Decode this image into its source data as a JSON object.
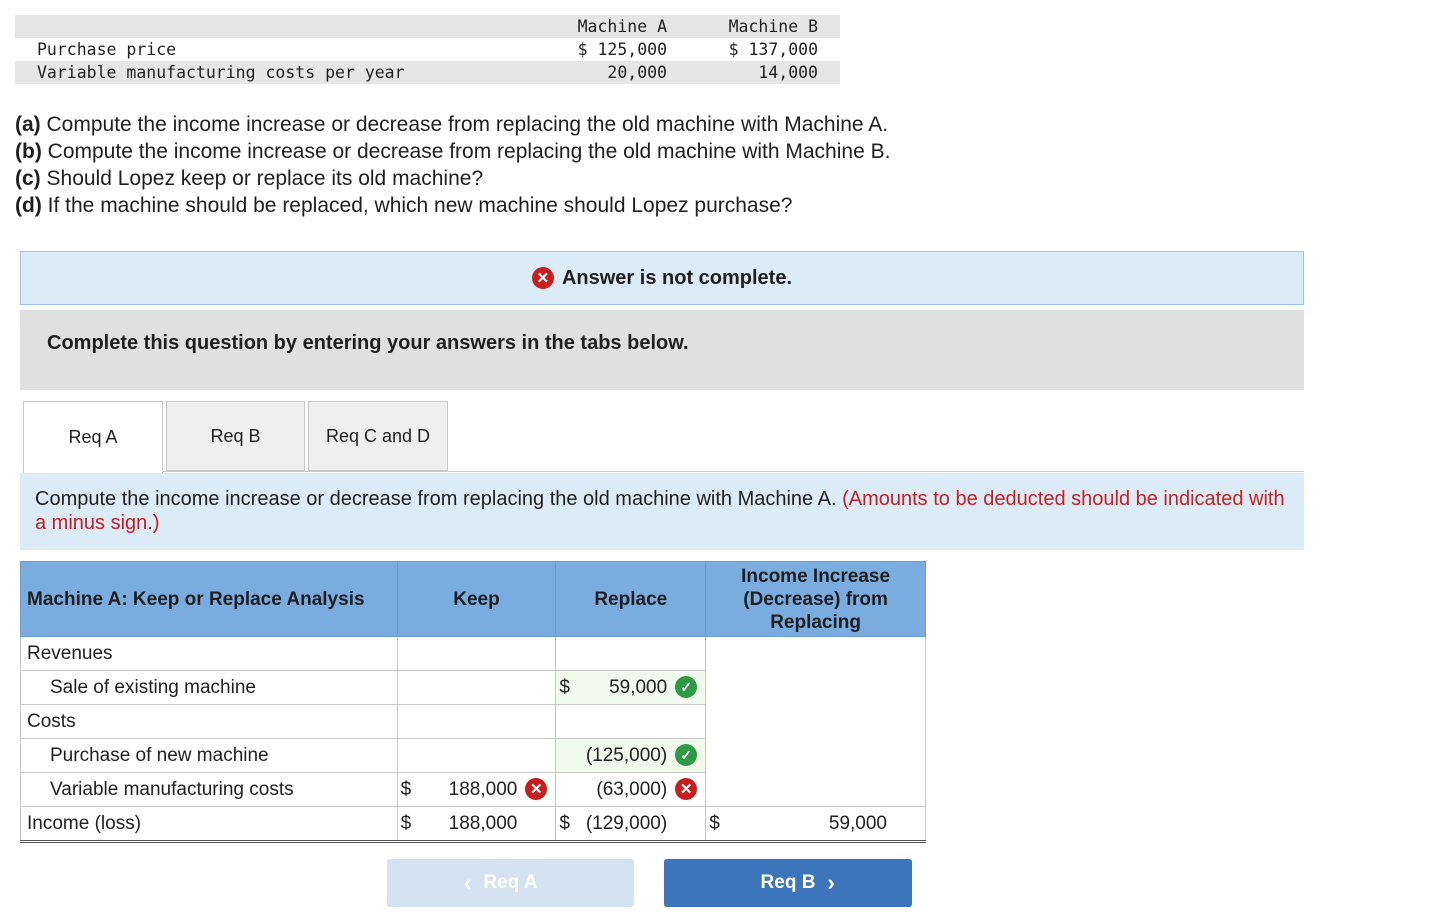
{
  "given_table": {
    "header_a": "Machine A",
    "header_b": "Machine B",
    "rows": [
      {
        "label": "Purchase price",
        "a": "$ 125,000",
        "b": "$ 137,000"
      },
      {
        "label": "Variable manufacturing costs per year",
        "a": "20,000",
        "b": "14,000"
      }
    ]
  },
  "questions": [
    {
      "tag": "(a)",
      "text": " Compute the income increase or decrease from replacing the old machine with Machine A."
    },
    {
      "tag": "(b)",
      "text": " Compute the income increase or decrease from replacing the old machine with Machine B."
    },
    {
      "tag": "(c)",
      "text": " Should Lopez keep or replace its old machine?"
    },
    {
      "tag": "(d)",
      "text": " If the machine should be replaced, which new machine should Lopez purchase?"
    }
  ],
  "banner": {
    "text": "Answer is not complete.",
    "icon": "x-circle-icon",
    "color": "#c81e1e"
  },
  "instruction": "Complete this question by entering your answers in the tabs below.",
  "tabs": [
    {
      "label": "Req A",
      "active": true
    },
    {
      "label": "Req B",
      "active": false
    },
    {
      "label": "Req C and D",
      "active": false
    }
  ],
  "prompt": {
    "text": "Compute the income increase or decrease from replacing the old machine with Machine A.",
    "note": "(Amounts to be deducted should be indicated with a minus sign.)"
  },
  "analysis": {
    "header": {
      "title": "Machine A: Keep or Replace Analysis",
      "keep": "Keep",
      "replace": "Replace",
      "diff": "Income Increase (Decrease) from Replacing"
    },
    "rows": {
      "revenues": "Revenues",
      "sale": {
        "label": "Sale of existing machine",
        "replace_dollar": "$",
        "replace": "59,000",
        "replace_status": "correct"
      },
      "costs": "Costs",
      "purchase": {
        "label": "Purchase of new machine",
        "replace": "(125,000)",
        "replace_status": "correct"
      },
      "variable": {
        "label": "Variable manufacturing costs",
        "keep_dollar": "$",
        "keep": "188,000",
        "keep_status": "incorrect",
        "replace": "(63,000)",
        "replace_status": "incorrect"
      },
      "income": {
        "label": "Income (loss)",
        "keep_dollar": "$",
        "keep": "188,000",
        "replace_dollar": "$",
        "replace": "(129,000)",
        "diff_dollar": "$",
        "diff": "59,000"
      }
    }
  },
  "nav": {
    "prev": "Req A",
    "next": "Req B"
  },
  "colors": {
    "header_blue": "#7aace0",
    "button_blue": "#3c75b9",
    "banner_bg": "#dcebf8",
    "correct_green": "#2e9a44",
    "incorrect_red": "#c81e1e"
  }
}
